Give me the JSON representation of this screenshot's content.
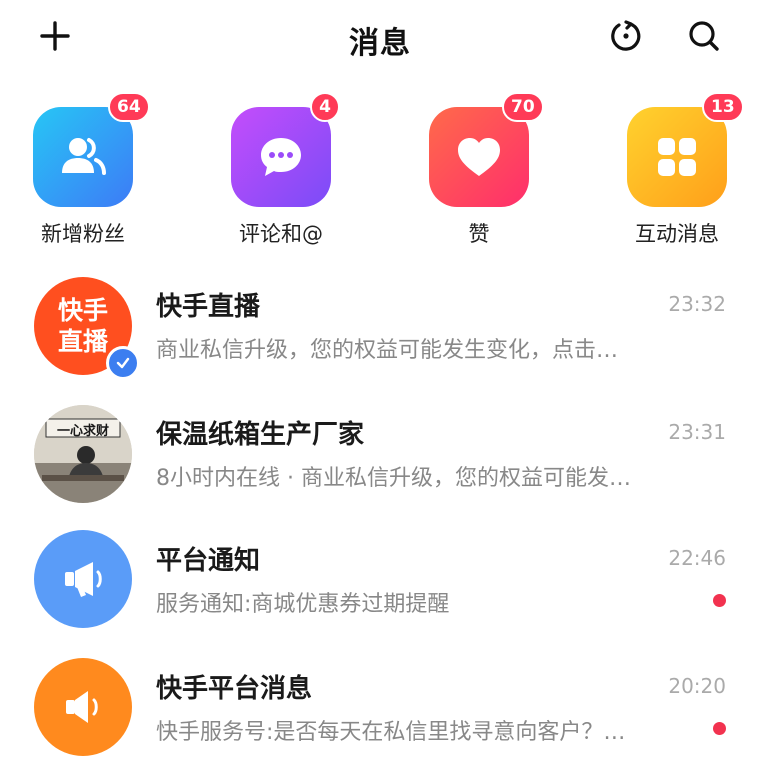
{
  "header": {
    "title": "消息",
    "add_icon": "plus-icon",
    "refresh_icon": "refresh-icon",
    "search_icon": "search-icon"
  },
  "tiles": [
    {
      "label": "新增粉丝",
      "badge": "64",
      "icon": "users-icon",
      "colors": [
        "#27c6f5",
        "#3d7bf6"
      ]
    },
    {
      "label": "评论和@",
      "badge": "4",
      "icon": "chat-bubble-icon",
      "colors": [
        "#c44dfb",
        "#7b4cf7"
      ]
    },
    {
      "label": "赞",
      "badge": "70",
      "icon": "heart-icon",
      "colors": [
        "#ff6a4a",
        "#ff2e6c"
      ]
    },
    {
      "label": "互动消息",
      "badge": "13",
      "icon": "grid-icon",
      "colors": [
        "#ffd22e",
        "#ff9f1a"
      ]
    }
  ],
  "conversations": [
    {
      "name": "快手直播",
      "time": "23:32",
      "preview": "商业私信升级，您的权益可能发生变化，点击…",
      "avatar_text": [
        "快手",
        "直播"
      ],
      "avatar_color": "#ff4f1f",
      "verified": true,
      "unread": false
    },
    {
      "name": "保温纸箱生产厂家",
      "time": "23:31",
      "preview": "8小时内在线 · 商业私信升级，您的权益可能发…",
      "avatar_text": [
        "一心求财"
      ],
      "avatar_color": "#d9d4c9",
      "verified": false,
      "unread": false
    },
    {
      "name": "平台通知",
      "time": "22:46",
      "preview": "服务通知:商城优惠券过期提醒",
      "avatar_icon": "megaphone-icon",
      "avatar_color": "#5a9cf8",
      "verified": false,
      "unread": true
    },
    {
      "name": "快手平台消息",
      "time": "20:20",
      "preview": "快手服务号:是否每天在私信里找寻意向客户？…",
      "avatar_icon": "speaker-icon",
      "avatar_color": "#ff8a1e",
      "verified": false,
      "unread": true
    }
  ],
  "colors": {
    "badge": "#ff3a57",
    "unread_dot": "#f2324f",
    "verified": "#3c7ef0"
  }
}
